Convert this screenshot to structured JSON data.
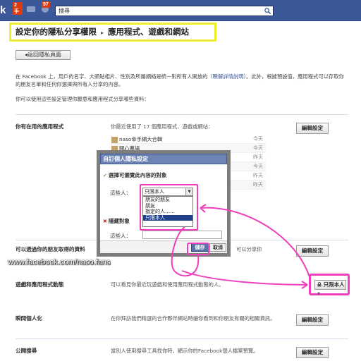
{
  "topbar": {
    "logo_text": "k",
    "requests_badge": "2手",
    "notifications_badge": "97",
    "search_placeholder": "搜尋"
  },
  "breadcrumb": {
    "root": "設定你的隱私分享權限",
    "separator": "▸",
    "current": "應用程式、遊戲和網站"
  },
  "back_button": "◂返回隱私頁面",
  "intro": {
    "text": "在 Facebook 上，用戶的名字、大頭貼相片、性別及所屬網絡是統一對所有人開放的（",
    "link": "瞭解詳情說明",
    "text2": "）。此外，根據預設值，應用程式可以存取你的朋友名單和任何你選擇與所有人分享的內容。",
    "line2": "你可以使用這些設定管理你願意和應用程式分享哪些資料："
  },
  "sections": {
    "apps_used": {
      "label": "你有在用的應用程式",
      "desc": "你最近使用了 17 個應用程式、遊戲或網站：",
      "button": "編輯設定",
      "apps": [
        {
          "name": "naso幸手網大合輯",
          "when": "今天"
        },
        {
          "name": "開心農場",
          "when": "今天"
        },
        {
          "name": "",
          "when": "昨天"
        },
        {
          "name": "",
          "when": "今天"
        },
        {
          "name": "",
          "when": "昨天"
        },
        {
          "name": "",
          "when": "昨天"
        }
      ]
    },
    "friends_access": {
      "label": "可以透過你的朋友取得的資料",
      "desc": "可以分享你",
      "button": "編輯設定"
    },
    "game_activity": {
      "label": "遊戲和應用程式動態",
      "desc": "可以看見你最近玩遊戲和使用應用程式動態的人。",
      "privacy_value": "只限本人"
    },
    "instant_personalization": {
      "label": "瞬間個人化",
      "desc": "在你拜訪我們精選的合作夥伴網站時讓你看到和你朋友有關的相關資訊。",
      "button": "編輯設定"
    },
    "public_search": {
      "label": "公開搜尋",
      "desc": "當別人使用搜尋工具找你時，顯示你的Facebook個人檔案預覽。",
      "button": "編輯設定"
    }
  },
  "dialog": {
    "title": "自訂個人隱私設定",
    "visible_section": "選擇可瀏覽此內容的對象",
    "these_people_label": "這些人：",
    "selected": "只限本人",
    "options": [
      "朋友的朋友",
      "朋友",
      "指定的人……",
      "只限本人"
    ],
    "hide_section": "隱藏對象",
    "hide_people_label": "這些人：",
    "save": "儲存",
    "cancel": "取消"
  },
  "watermark": "www.facebook.com/naso.fans",
  "colors": {
    "facebook_blue": "#3b5998",
    "highlight_yellow": "#f0ef2c",
    "highlight_pink": "#ef3fbd"
  }
}
